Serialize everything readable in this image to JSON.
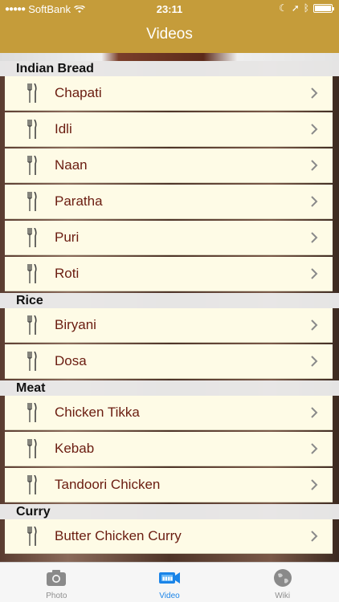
{
  "status_bar": {
    "carrier": "SoftBank",
    "time": "23:11"
  },
  "nav": {
    "title": "Videos"
  },
  "sections": [
    {
      "header": "Indian Bread",
      "items": [
        "Chapati",
        "Idli",
        "Naan",
        "Paratha",
        "Puri",
        "Roti"
      ]
    },
    {
      "header": "Rice",
      "items": [
        "Biryani",
        "Dosa"
      ]
    },
    {
      "header": "Meat",
      "items": [
        "Chicken Tikka",
        "Kebab",
        "Tandoori Chicken"
      ]
    },
    {
      "header": "Curry",
      "items": [
        "Butter Chicken Curry"
      ]
    }
  ],
  "tabbar": {
    "tabs": [
      {
        "label": "Photo",
        "icon": "camera-icon",
        "active": false
      },
      {
        "label": "Video",
        "icon": "video-camera-icon",
        "active": true
      },
      {
        "label": "Wiki",
        "icon": "globe-icon",
        "active": false
      }
    ]
  },
  "colors": {
    "nav_bar": "#c59c3a",
    "row_background": "#fefbe6",
    "row_text": "#6a1c10",
    "tab_active": "#1a84e8"
  }
}
